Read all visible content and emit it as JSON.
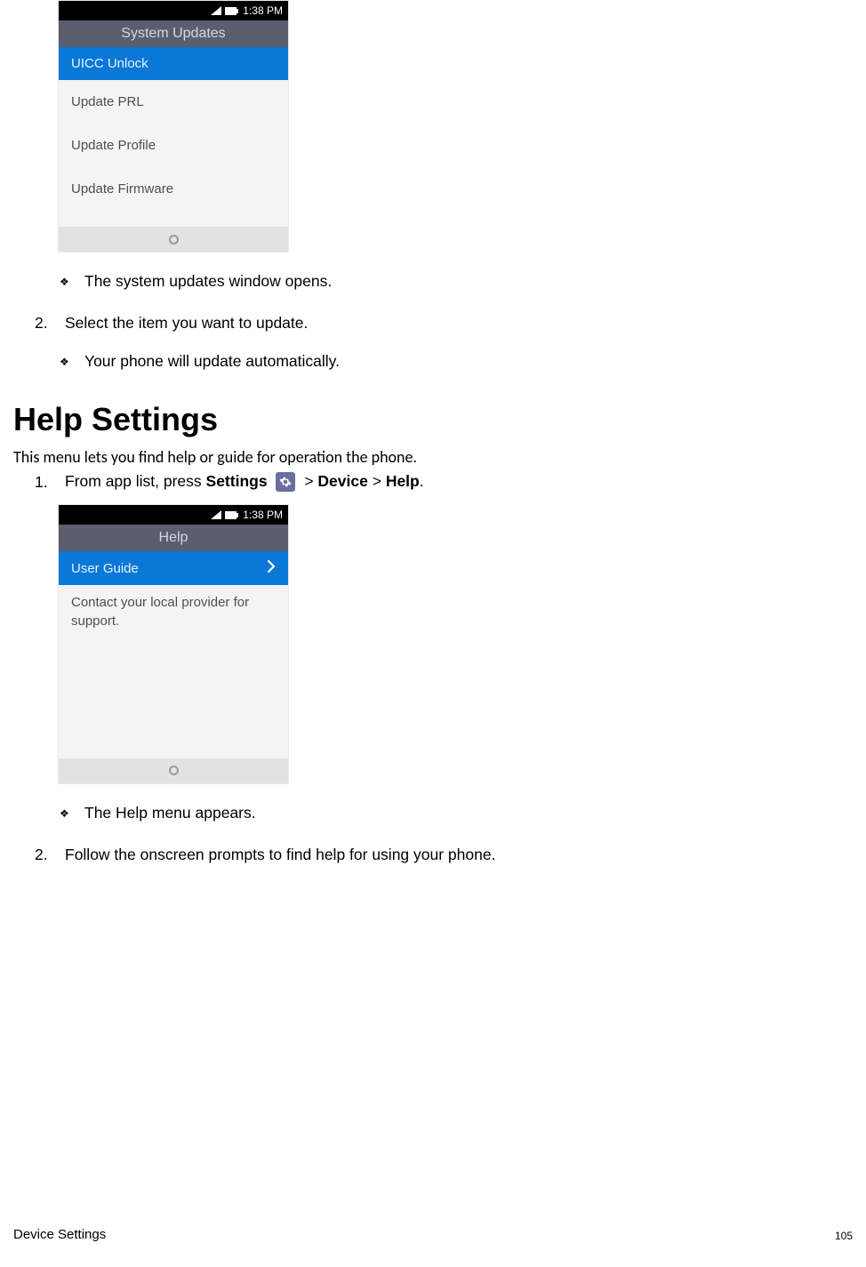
{
  "phone1": {
    "time": "1:38 PM",
    "header": "System Updates",
    "items": {
      "uicc": "UICC Unlock",
      "prl": "Update PRL",
      "profile": "Update Profile",
      "firmware": "Update Firmware"
    }
  },
  "doc": {
    "bullet_opens": "The system updates window opens.",
    "step2a_num": "2.",
    "step2a": "Select the item you want to update.",
    "bullet_update": "Your phone will update automatically.",
    "heading": "Help Settings",
    "intro": "This menu lets you find help or guide for operation the phone.",
    "step1_num": "1.",
    "step1_prefix": "From app list, press ",
    "step1_settings": "Settings",
    "step1_sep1": " > ",
    "step1_device": "Device",
    "step1_sep2": " > ",
    "step1_help": "Help",
    "step1_period": ".",
    "bullet_helpappears": "The Help menu appears.",
    "step2b_num": "2.",
    "step2b": "Follow the onscreen prompts to find help for using your phone."
  },
  "phone2": {
    "time": "1:38 PM",
    "header": "Help",
    "userguide": "User Guide",
    "contact": "Contact your local provider for support."
  },
  "footer": {
    "section": "Device Settings",
    "page": "105"
  }
}
